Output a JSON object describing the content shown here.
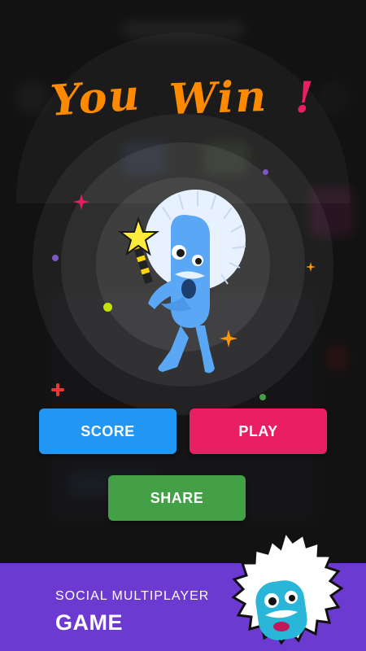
{
  "title": {
    "text_parts": [
      "You",
      "Win",
      "!"
    ],
    "colors": [
      "#ff8a00",
      "#ff8a00",
      "#e91e63"
    ]
  },
  "buttons": {
    "score_label": "SCORE",
    "play_label": "PLAY",
    "share_label": "SHARE"
  },
  "footer": {
    "tagline": "SOCIAL MULTIPLAYER",
    "headline": "GAME"
  },
  "colors": {
    "score": "#2196f3",
    "play": "#e91e63",
    "share": "#43a047",
    "footer": "#6c3ad1",
    "mascot": "#5aa8f5"
  },
  "icons": [
    "star-wand-icon",
    "sparkle-icon",
    "plus-icon",
    "dot-icon"
  ]
}
